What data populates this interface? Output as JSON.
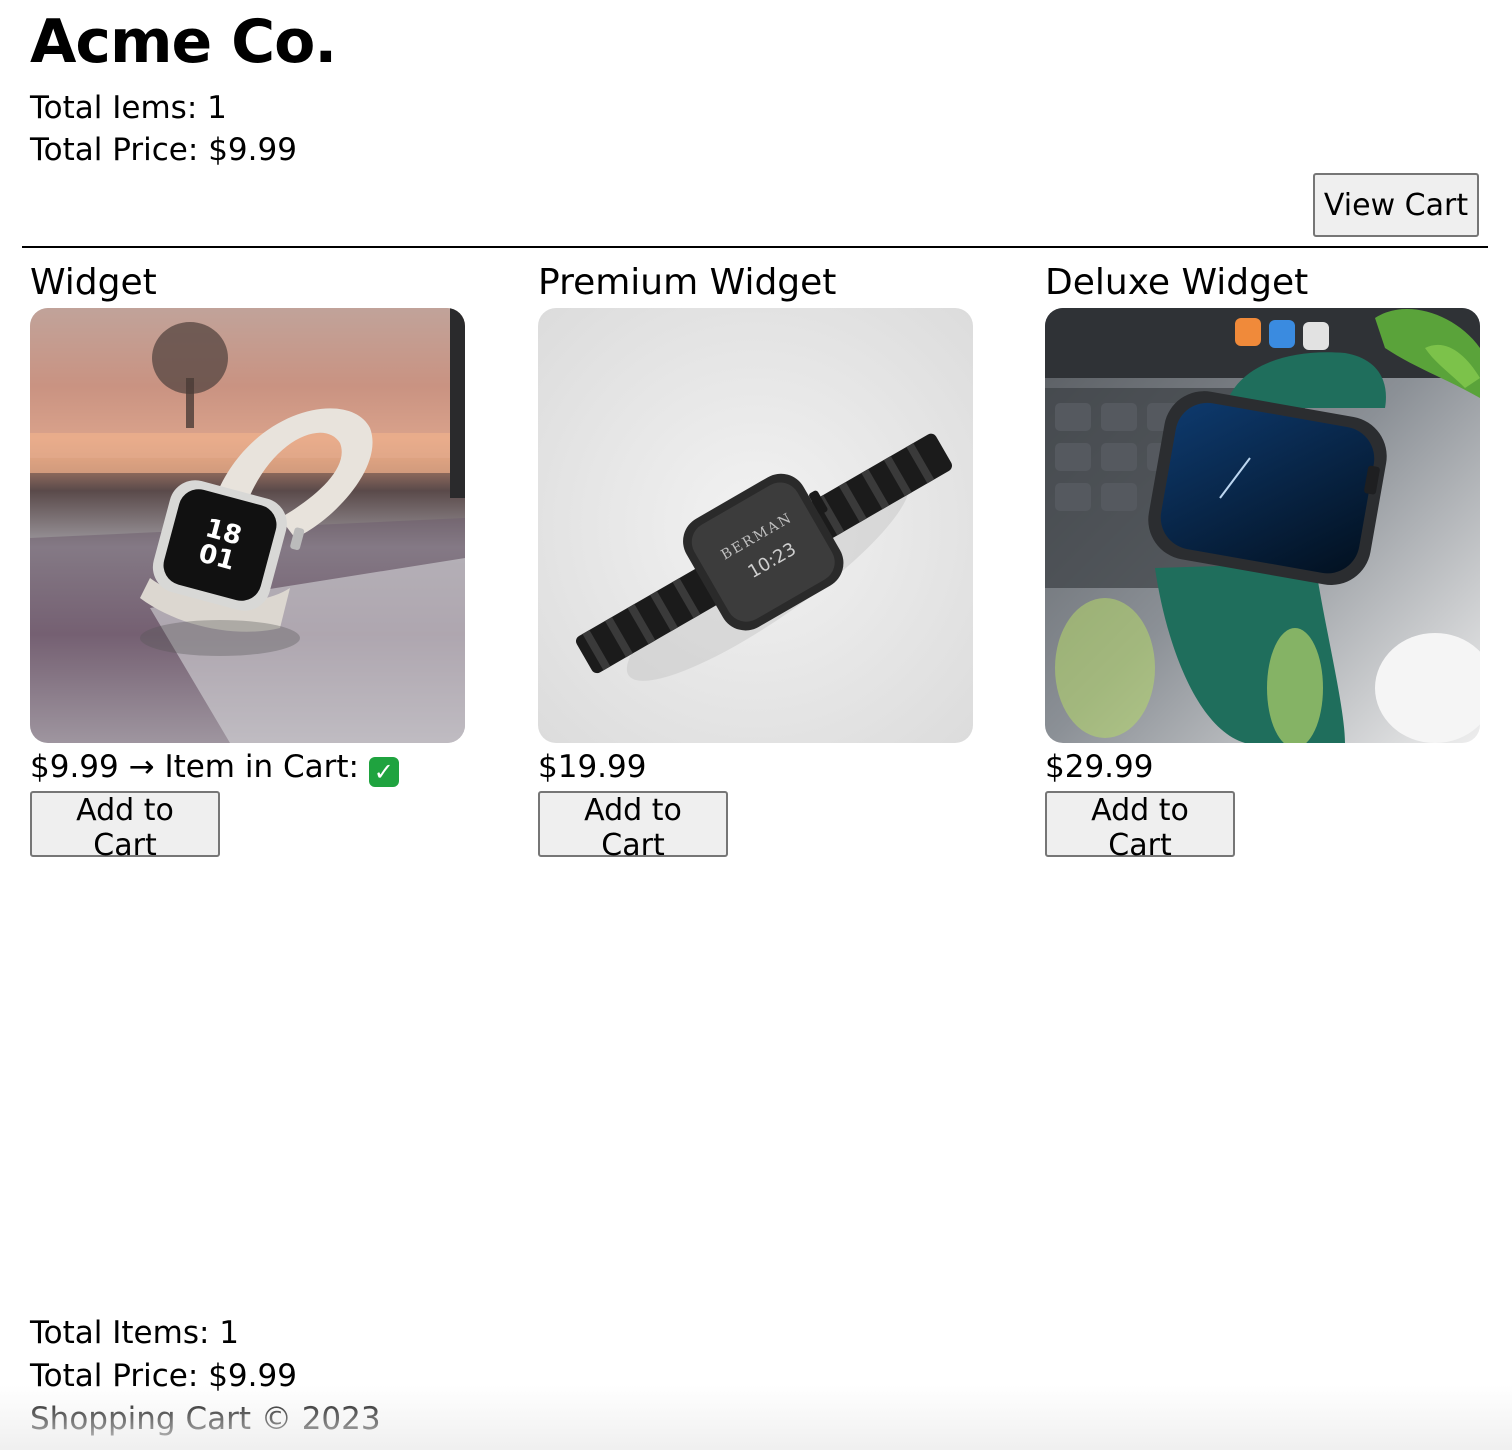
{
  "header": {
    "brand": "Acme Co.",
    "total_items_label": "Total Iems:",
    "total_items_value": "1",
    "total_price_label": "Total Price:",
    "total_price_value": "$9.99",
    "view_cart_label": "View Cart"
  },
  "products": [
    {
      "name": "Widget",
      "price": "$9.99",
      "in_cart_note": "→ Item in Cart:",
      "in_cart_icon": "✅",
      "add_label": "Add to Cart",
      "image": "white-watch-on-laptop"
    },
    {
      "name": "Premium Widget",
      "price": "$19.99",
      "add_label": "Add to Cart",
      "image": "black-watch-metal-band"
    },
    {
      "name": "Deluxe Widget",
      "price": "$29.99",
      "add_label": "Add to Cart",
      "image": "green-leather-watch"
    }
  ],
  "footer": {
    "total_items_label": "Total Items:",
    "total_items_value": "1",
    "total_price_label": "Total Price:",
    "total_price_value": "$9.99",
    "copyright": "Shopping Cart © 2023"
  },
  "colors": {
    "button_bg": "#efefef",
    "button_border": "#767676",
    "check_green": "#1fa33f"
  }
}
